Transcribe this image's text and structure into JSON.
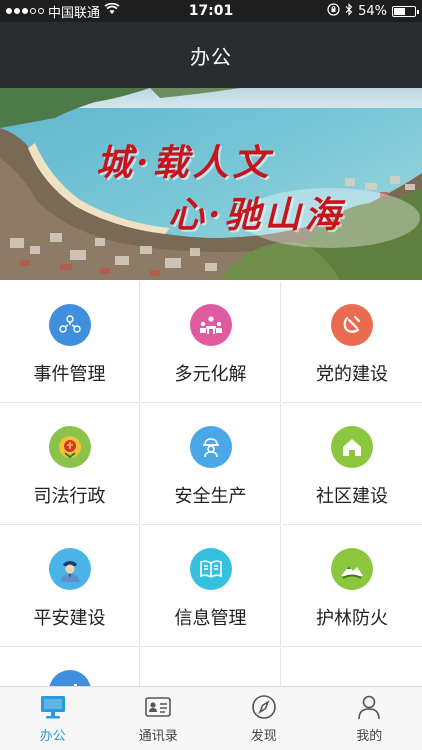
{
  "status_bar": {
    "carrier": "中国联通",
    "time": "17:01",
    "battery": "54%",
    "battery_level": 0.54,
    "signal_bars": 3
  },
  "header": {
    "title": "办公"
  },
  "banner": {
    "line1": "城·载人文",
    "line2": "心·驰山海"
  },
  "grid": {
    "items": [
      {
        "label": "事件管理",
        "icon": "people-network-icon",
        "color": "#3f8fdc"
      },
      {
        "label": "多元化解",
        "icon": "meeting-icon",
        "color": "#e05aa0"
      },
      {
        "label": "党的建设",
        "icon": "hammer-sickle-icon",
        "color": "#ec6a4f"
      },
      {
        "label": "司法行政",
        "icon": "justice-emblem-icon",
        "color": "#8bc34a"
      },
      {
        "label": "安全生产",
        "icon": "hardhat-worker-icon",
        "color": "#4aa8e8"
      },
      {
        "label": "社区建设",
        "icon": "house-icon",
        "color": "#8cc63f"
      },
      {
        "label": "平安建设",
        "icon": "police-officer-icon",
        "color": "#4ab3e8"
      },
      {
        "label": "信息管理",
        "icon": "open-book-icon",
        "color": "#35c0e0"
      },
      {
        "label": "护林防火",
        "icon": "forest-mountain-icon",
        "color": "#8cc63f"
      },
      {
        "label": "",
        "icon": "chart-icon",
        "color": "#3f8fdc"
      }
    ]
  },
  "tabbar": {
    "tabs": [
      {
        "label": "办公",
        "icon": "monitor-icon",
        "active": true
      },
      {
        "label": "通讯录",
        "icon": "contact-card-icon",
        "active": false
      },
      {
        "label": "发现",
        "icon": "compass-icon",
        "active": false
      },
      {
        "label": "我的",
        "icon": "user-icon",
        "active": false
      }
    ]
  },
  "colors": {
    "accent": "#2b9be0",
    "header_bg": "#2a2d30",
    "banner_text": "#c8141c"
  }
}
